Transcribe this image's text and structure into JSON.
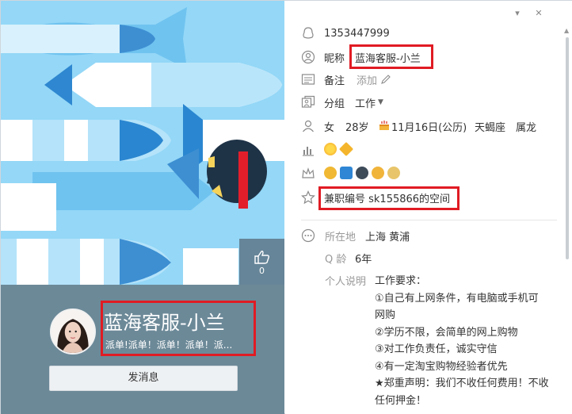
{
  "window": {
    "minimize_glyph": "▾",
    "close_glyph": "✕"
  },
  "cover": {
    "like_count": "0"
  },
  "profile": {
    "display_name": "蓝海客服-小兰",
    "signature": "派单!派单！派单！派单！派...",
    "send_message_label": "发消息"
  },
  "info": {
    "qq_number": "1353447999",
    "nickname_label": "昵称",
    "nickname": "蓝海客服-小兰",
    "remark_label": "备注",
    "remark_value": "添加",
    "group_label": "分组",
    "group_value": "工作",
    "gender": "女",
    "age": "28岁",
    "birthday": "11月16日(公历)",
    "zodiac": "天蝎座",
    "chinese_zodiac": "属龙",
    "space_text": "兼职编号 sk155866的空间",
    "location_label": "所在地",
    "location_value": "上海 黄浦",
    "qage_label": "Q 龄",
    "qage_value": "6年",
    "intro_label": "个人说明",
    "intro_lines": [
      "工作要求：",
      "①自己有上网条件，有电脑或手机可",
      "网购",
      "②学历不限，会简单的网上购物",
      "③对工作负责任，诚实守信",
      "④有一定淘宝购物经验者优先",
      "★郑重声明：我们不收任何费用！不收",
      "任何押金！"
    ]
  },
  "icons": {
    "qq": "qq-penguin-icon",
    "nickname": "user-circle-icon",
    "remark": "card-icon",
    "group": "group-icon",
    "person": "person-icon",
    "level": "level-bars-icon",
    "vip": "crown-icon",
    "space": "star-outline-icon",
    "more": "ellipsis-circle-icon",
    "edit": "pencil-icon",
    "cake": "cake-icon",
    "like": "thumbs-up-icon"
  },
  "colors": {
    "accent_red": "#e01b23",
    "card_bg": "#6c8998",
    "cover_bg": "#8fd3f5"
  }
}
